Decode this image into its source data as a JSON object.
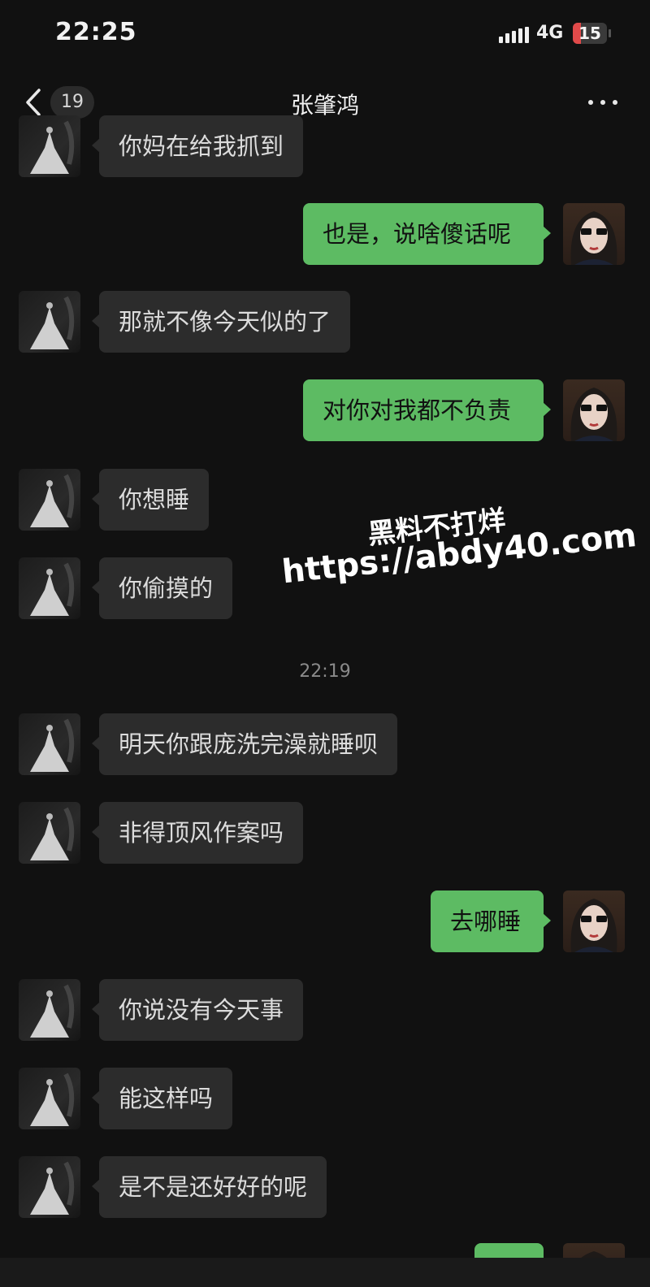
{
  "status_bar": {
    "time": "22:25",
    "network": "4G",
    "battery": "15"
  },
  "nav": {
    "back_badge": "19",
    "title": "张肇鸿"
  },
  "messages": [
    {
      "side": "left",
      "text": "你妈在给我抓到"
    },
    {
      "side": "right",
      "text": "也是，说啥傻话呢"
    },
    {
      "side": "left",
      "text": "那就不像今天似的了"
    },
    {
      "side": "right",
      "text": "对你对我都不负责"
    },
    {
      "side": "left",
      "text": "你想睡"
    },
    {
      "side": "left",
      "text": "你偷摸的"
    },
    {
      "side": "time",
      "text": "22:19"
    },
    {
      "side": "left",
      "text": "明天你跟庞洗完澡就睡呗"
    },
    {
      "side": "left",
      "text": "非得顶风作案吗"
    },
    {
      "side": "right",
      "text": "去哪睡"
    },
    {
      "side": "left",
      "text": "你说没有今天事"
    },
    {
      "side": "left",
      "text": "能这样吗"
    },
    {
      "side": "left",
      "text": "是不是还好好的呢"
    },
    {
      "side": "right",
      "text": ""
    }
  ],
  "watermark": {
    "line1": "黑料不打烊",
    "line2": "https://abdy40.com"
  },
  "icons": {
    "back": "chevron-left-icon",
    "more": "more-dots-icon",
    "signal": "signal-icon",
    "battery": "battery-icon"
  },
  "colors": {
    "background": "#111111",
    "sent_bubble": "#5dbb63",
    "received_bubble": "#2c2c2c",
    "battery_low": "#e14a4a"
  }
}
